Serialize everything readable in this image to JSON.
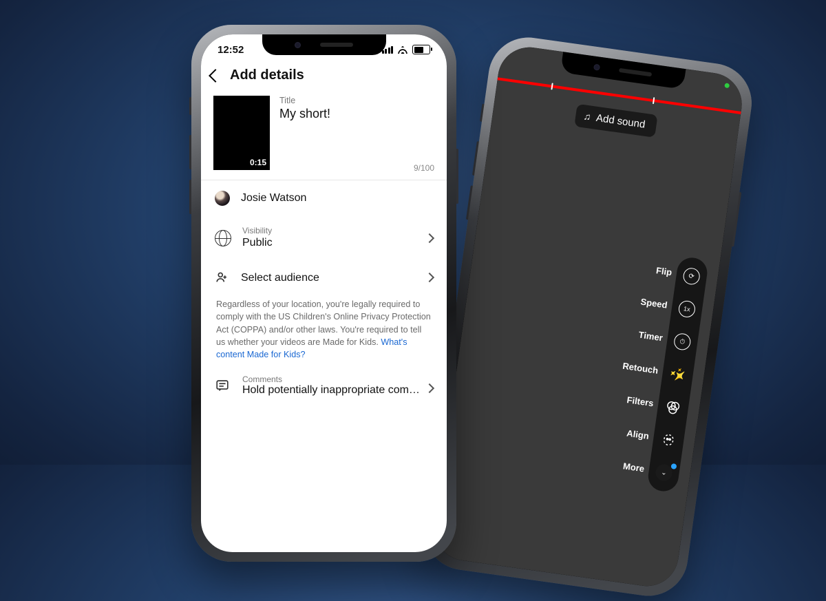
{
  "front": {
    "status_time": "12:52",
    "header": "Add details",
    "thumbnail_duration": "0:15",
    "title_label": "Title",
    "title_value": "My short!",
    "title_counter": "9/100",
    "account_name": "Josie Watson",
    "visibility_label": "Visibility",
    "visibility_value": "Public",
    "audience_label": "Select audience",
    "coppa_text": "Regardless of your location, you're legally required to comply with the US Children's Online Privacy Protection Act (COPPA) and/or other laws. You're required to tell us whether your videos are Made for Kids. ",
    "coppa_link": "What's content Made for Kids?",
    "comments_label": "Comments",
    "comments_value": "Hold potentially inappropriate com…"
  },
  "back": {
    "add_sound": "Add sound",
    "tools": {
      "flip": "Flip",
      "speed": "Speed",
      "timer": "Timer",
      "retouch": "Retouch",
      "filters": "Filters",
      "align": "Align",
      "more": "More"
    }
  }
}
